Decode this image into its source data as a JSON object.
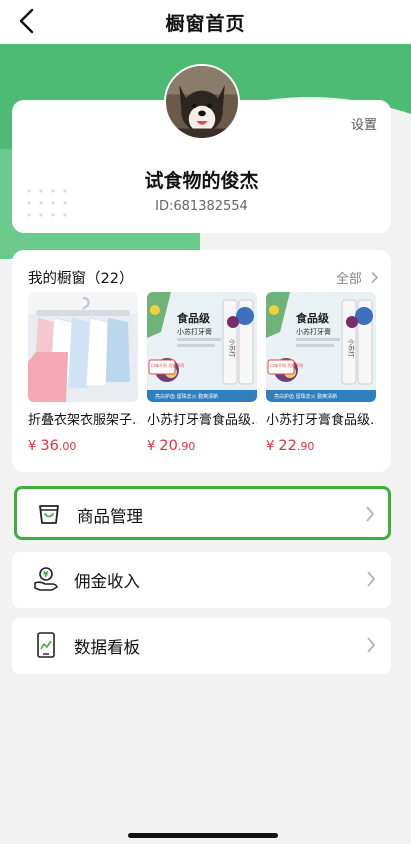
{
  "nav": {
    "title": "橱窗首页",
    "back_icon": "chevron-left-icon"
  },
  "profile": {
    "settings_label": "设置",
    "username": "试食物的俊杰",
    "user_id": "ID:681382554",
    "avatar": "dog-avatar"
  },
  "window": {
    "title": "我的橱窗（22）",
    "all_label": "全部",
    "products": [
      {
        "name": "折叠衣架衣服架子…",
        "currency": "¥ ",
        "price_int": "36",
        "price_dec": ".00"
      },
      {
        "name": "小苏打牙膏食品级…",
        "currency": "¥ ",
        "price_int": "20",
        "price_dec": ".90"
      },
      {
        "name": "小苏打牙膏食品级…",
        "currency": "¥ ",
        "price_int": "22",
        "price_dec": ".90"
      }
    ],
    "toothpaste_text": {
      "badge": "食品级",
      "subtitle": "小苏打牙膏",
      "tube": "小苏打",
      "bubble": "口味不同 功效不同",
      "banner": "亮白护齿  留珠去火  勤爽清新"
    }
  },
  "menu": [
    {
      "label": "商品管理",
      "icon": "shopping-bag-icon",
      "selected": true
    },
    {
      "label": "佣金收入",
      "icon": "money-hand-icon",
      "selected": false
    },
    {
      "label": "数据看板",
      "icon": "chart-tablet-icon",
      "selected": false
    }
  ],
  "colors": {
    "accent_green": "#4dbb74",
    "price_red": "#e0313a",
    "selected_border": "#3fae3a"
  }
}
